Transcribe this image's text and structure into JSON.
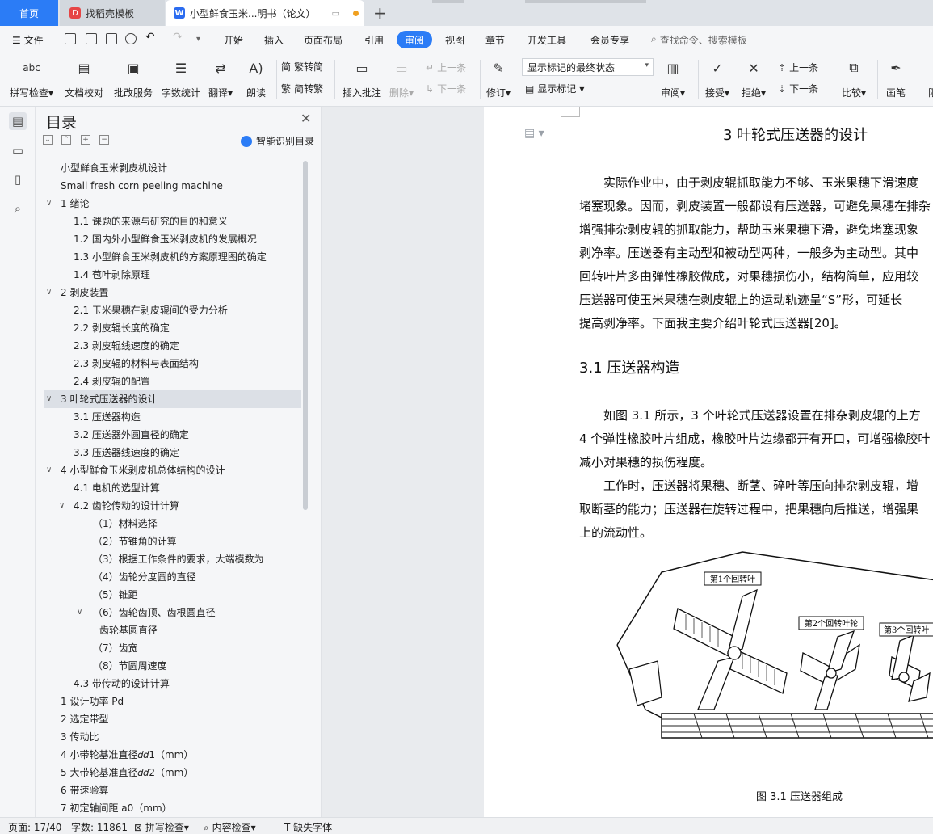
{
  "tabs": {
    "home": "首页",
    "find_template": "找稻壳模板",
    "document": "小型鲜食玉米...明书（论文）"
  },
  "menu": {
    "file": "文件",
    "items": [
      "开始",
      "插入",
      "页面布局",
      "引用",
      "审阅",
      "视图",
      "章节",
      "开发工具",
      "会员专享"
    ],
    "active": "审阅",
    "search": "查找命令、搜索模板"
  },
  "ribbon": {
    "spell_check": "拼写检查",
    "doc_proof": "文档校对",
    "batch_service": "批改服务",
    "word_count": "字数统计",
    "translate": "翻译",
    "read_aloud": "朗读",
    "trad_to_simp": "繁转简",
    "simp_to_trad": "简转繁",
    "insert_comment": "插入批注",
    "delete": "删除",
    "prev_comment": "上一条",
    "next_comment": "下一条",
    "revise": "修订",
    "markup_state": "显示标记的最终状态",
    "show_markup": "显示标记",
    "review": "审阅",
    "accept": "接受",
    "reject": "拒绝",
    "prev_change": "上一条",
    "next_change": "下一条",
    "compare": "比较",
    "pen": "画笔",
    "limit": "限"
  },
  "toc": {
    "title": "目录",
    "smart": "智能识别目录",
    "items": [
      {
        "text": "小型鲜食玉米剥皮机设计",
        "level": 0,
        "arrow": ""
      },
      {
        "text": "Small fresh corn peeling machine",
        "level": 0,
        "arrow": ""
      },
      {
        "text": "1   绪论",
        "level": 0,
        "arrow": "v"
      },
      {
        "text": "1.1  课题的来源与研究的目的和意义",
        "level": 1,
        "arrow": ""
      },
      {
        "text": "1.2  国内外小型鲜食玉米剥皮机的发展概况",
        "level": 1,
        "arrow": ""
      },
      {
        "text": "1.3  小型鲜食玉米剥皮机的方案原理图的确定",
        "level": 1,
        "arrow": ""
      },
      {
        "text": "1.4  苞叶剥除原理",
        "level": 1,
        "arrow": ""
      },
      {
        "text": "2 剥皮装置",
        "level": 0,
        "arrow": "v"
      },
      {
        "text": "2.1  玉米果穗在剥皮辊间的受力分析",
        "level": 1,
        "arrow": ""
      },
      {
        "text": "2.2  剥皮辊长度的确定",
        "level": 1,
        "arrow": ""
      },
      {
        "text": "2.3  剥皮辊线速度的确定",
        "level": 1,
        "arrow": ""
      },
      {
        "text": "2.3  剥皮辊的材料与表面结构",
        "level": 1,
        "arrow": ""
      },
      {
        "text": "2.4  剥皮辊的配置",
        "level": 1,
        "arrow": ""
      },
      {
        "text": "3 叶轮式压送器的设计",
        "level": 0,
        "arrow": "v",
        "selected": true
      },
      {
        "text": "3.1  压送器构造",
        "level": 1,
        "arrow": ""
      },
      {
        "text": "3.2  压送器外圆直径的确定",
        "level": 1,
        "arrow": ""
      },
      {
        "text": "3.3  压送器线速度的确定",
        "level": 1,
        "arrow": ""
      },
      {
        "text": "4 小型鲜食玉米剥皮机总体结构的设计",
        "level": 0,
        "arrow": "v"
      },
      {
        "text": "4.1  电机的选型计算",
        "level": 1,
        "arrow": ""
      },
      {
        "text": "4.2  齿轮传动的设计计算",
        "level": 1,
        "arrow": "v"
      },
      {
        "text": "（1）材料选择",
        "level": 2,
        "arrow": ""
      },
      {
        "text": "（2）节锥角的计算",
        "level": 2,
        "arrow": ""
      },
      {
        "text": "（3）根据工作条件的要求，大端模数为",
        "level": 2,
        "arrow": ""
      },
      {
        "text": "（4）齿轮分度圆的直径",
        "level": 2,
        "arrow": ""
      },
      {
        "text": "（5）锥距",
        "level": 2,
        "arrow": ""
      },
      {
        "text": "（6）齿轮齿顶、齿根圆直径",
        "level": 2,
        "arrow": "v"
      },
      {
        "text": "齿轮基圆直径",
        "level": 3,
        "arrow": ""
      },
      {
        "text": "（7）齿宽",
        "level": 2,
        "arrow": ""
      },
      {
        "text": "（8）节圆周速度",
        "level": 2,
        "arrow": ""
      },
      {
        "text": "4.3  带传动的设计计算",
        "level": 1,
        "arrow": ""
      },
      {
        "text": "1 设计功率 Pd",
        "level": 0,
        "arrow": ""
      },
      {
        "text": "2 选定带型",
        "level": 0,
        "arrow": ""
      },
      {
        "text": "3  传动比",
        "level": 0,
        "arrow": ""
      },
      {
        "text": "4  小带轮基准直径𝑑𝑑1（mm）",
        "level": 0,
        "arrow": ""
      },
      {
        "text": "5  大带轮基准直径𝑑𝑑2（mm）",
        "level": 0,
        "arrow": ""
      },
      {
        "text": "6  带速验算",
        "level": 0,
        "arrow": ""
      },
      {
        "text": "7  初定轴间距 a0（mm）",
        "level": 0,
        "arrow": ""
      }
    ]
  },
  "doc": {
    "heading": "3 叶轮式压送器的设计",
    "para1": [
      "　　实际作业中，由于剥皮辊抓取能力不够、玉米果穗下滑速度",
      "堵塞现象。因而，剥皮装置一般都设有压送器，可避免果穗在排杂",
      "增强排杂剥皮辊的抓取能力，帮助玉米果穗下滑，避免堵塞现象",
      "剥净率。压送器有主动型和被动型两种，一般多为主动型。其中",
      "回转叶片多由弹性橡胶做成，对果穗损伤小，结构简单，应用较",
      "压送器可使玉米果穗在剥皮辊上的运动轨迹呈“S”形，可延长",
      "提高剥净率。下面我主要介绍叶轮式压送器[20]。"
    ],
    "subheading": "3.1  压送器构造",
    "para2": [
      "　　如图 3.1 所示，3 个叶轮式压送器设置在排杂剥皮辊的上方",
      "4 个弹性橡胶叶片组成，橡胶叶片边缘都开有开口，可增强橡胶叶",
      "减小对果穗的损伤程度。",
      "　　工作时，压送器将果穗、断茎、碎叶等压向排杂剥皮辊，增",
      "取断茎的能力；压送器在旋转过程中，把果穗向后推送，增强果",
      "上的流动性。"
    ],
    "fig_labels": [
      "第1个回转叶",
      "第2个回转叶轮",
      "第3个回转叶"
    ],
    "fig_caption": "图 3.1  压送器组成"
  },
  "status": {
    "page": "页面: 17/40",
    "words": "字数: 11861",
    "spell": "拼写检查",
    "content_check": "内容检查",
    "missing_font": "缺失字体"
  }
}
